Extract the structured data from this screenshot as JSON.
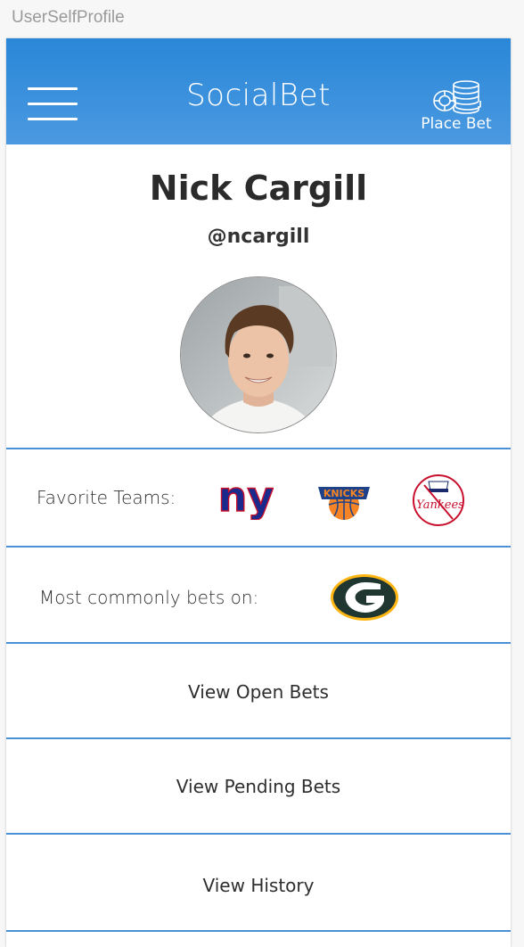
{
  "frame_title": "UserSelfProfile",
  "header": {
    "title": "SocialBet",
    "menu_icon": "hamburger-menu-icon",
    "place_bet_icon": "poker-chips-icon",
    "place_bet_label": "Place Bet",
    "background_color": "#2a87d8"
  },
  "profile": {
    "name": "Nick Cargill",
    "handle": "@ncargill"
  },
  "favorite_teams": {
    "label": "Favorite Teams:",
    "teams": [
      {
        "name": "New York Giants",
        "logo_icon": "giants-ny-logo-icon",
        "logo_text": "ny"
      },
      {
        "name": "New York Knicks",
        "logo_icon": "knicks-logo-icon",
        "logo_text": "KNICKS"
      },
      {
        "name": "New York Yankees",
        "logo_icon": "yankees-logo-icon",
        "logo_text": "Yankees"
      }
    ]
  },
  "common_bets": {
    "label": "Most commonly bets on:",
    "teams": [
      {
        "name": "Green Bay Packers",
        "logo_icon": "packers-g-logo-icon",
        "logo_text": "G"
      }
    ]
  },
  "nav": {
    "open_bets": "View Open Bets",
    "pending_bets": "View Pending Bets",
    "history": "View History"
  },
  "colors": {
    "accent": "#4a90d4",
    "header": "#2a87d8"
  }
}
